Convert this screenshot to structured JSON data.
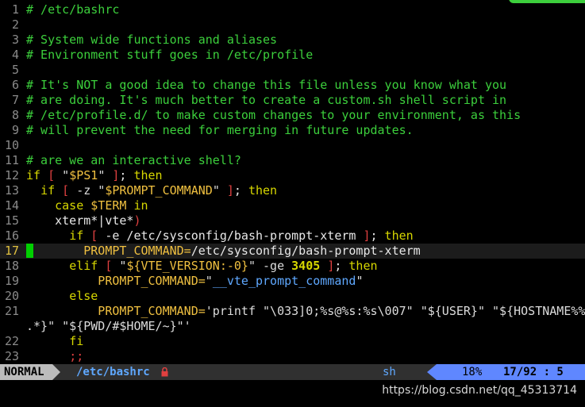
{
  "lines": [
    {
      "n": "1",
      "spans": [
        {
          "t": "# /etc/bashrc",
          "c": "c-com"
        }
      ]
    },
    {
      "n": "2",
      "spans": []
    },
    {
      "n": "3",
      "spans": [
        {
          "t": "# System wide functions and aliases",
          "c": "c-com"
        }
      ]
    },
    {
      "n": "4",
      "spans": [
        {
          "t": "# Environment stuff goes in /etc/profile",
          "c": "c-com"
        }
      ]
    },
    {
      "n": "5",
      "spans": []
    },
    {
      "n": "6",
      "spans": [
        {
          "t": "# It's NOT a good idea to change this file unless you know what you",
          "c": "c-com"
        }
      ]
    },
    {
      "n": "7",
      "spans": [
        {
          "t": "# are doing. It's much better to create a custom.sh shell script in",
          "c": "c-com"
        }
      ]
    },
    {
      "n": "8",
      "spans": [
        {
          "t": "# /etc/profile.d/ to make custom changes to your environment, as this",
          "c": "c-com"
        }
      ]
    },
    {
      "n": "9",
      "spans": [
        {
          "t": "# will prevent the need for merging in future updates.",
          "c": "c-com"
        }
      ]
    },
    {
      "n": "10",
      "spans": []
    },
    {
      "n": "11",
      "spans": [
        {
          "t": "# are we an interactive shell?",
          "c": "c-com"
        }
      ]
    },
    {
      "n": "12",
      "spans": [
        {
          "t": "if",
          "c": "c-kw"
        },
        {
          "t": " ",
          "c": "c-txt"
        },
        {
          "t": "[",
          "c": "c-red"
        },
        {
          "t": " \"",
          "c": "c-str"
        },
        {
          "t": "$PS1",
          "c": "c-var"
        },
        {
          "t": "\" ",
          "c": "c-str"
        },
        {
          "t": "]",
          "c": "c-red"
        },
        {
          "t": "; ",
          "c": "c-txt"
        },
        {
          "t": "then",
          "c": "c-kw"
        }
      ]
    },
    {
      "n": "13",
      "spans": [
        {
          "t": "  ",
          "c": "c-txt"
        },
        {
          "t": "if",
          "c": "c-kw"
        },
        {
          "t": " ",
          "c": "c-txt"
        },
        {
          "t": "[",
          "c": "c-red"
        },
        {
          "t": " -z \"",
          "c": "c-str"
        },
        {
          "t": "$PROMPT_COMMAND",
          "c": "c-var"
        },
        {
          "t": "\" ",
          "c": "c-str"
        },
        {
          "t": "]",
          "c": "c-red"
        },
        {
          "t": "; ",
          "c": "c-txt"
        },
        {
          "t": "then",
          "c": "c-kw"
        }
      ]
    },
    {
      "n": "14",
      "spans": [
        {
          "t": "    ",
          "c": "c-txt"
        },
        {
          "t": "case",
          "c": "c-kw"
        },
        {
          "t": " ",
          "c": "c-txt"
        },
        {
          "t": "$TERM",
          "c": "c-var"
        },
        {
          "t": " ",
          "c": "c-txt"
        },
        {
          "t": "in",
          "c": "c-kw"
        }
      ]
    },
    {
      "n": "15",
      "spans": [
        {
          "t": "    xterm*|vte*",
          "c": "c-txt"
        },
        {
          "t": ")",
          "c": "c-red"
        }
      ]
    },
    {
      "n": "16",
      "spans": [
        {
          "t": "      ",
          "c": "c-txt"
        },
        {
          "t": "if",
          "c": "c-kw"
        },
        {
          "t": " ",
          "c": "c-txt"
        },
        {
          "t": "[",
          "c": "c-red"
        },
        {
          "t": " -e /etc/sysconfig/bash-prompt-xterm ",
          "c": "c-txt"
        },
        {
          "t": "]",
          "c": "c-red"
        },
        {
          "t": "; ",
          "c": "c-txt"
        },
        {
          "t": "then",
          "c": "c-kw"
        }
      ]
    },
    {
      "n": "17",
      "cur": true,
      "spans": [
        {
          "t": " ",
          "c": "cursor"
        },
        {
          "t": "       PROMPT_COMMAND=",
          "c": "c-var"
        },
        {
          "t": "/etc/sysconfig/bash-prompt-xterm",
          "c": "c-txt"
        }
      ]
    },
    {
      "n": "18",
      "spans": [
        {
          "t": "      ",
          "c": "c-txt"
        },
        {
          "t": "elif",
          "c": "c-kw"
        },
        {
          "t": " ",
          "c": "c-txt"
        },
        {
          "t": "[",
          "c": "c-red"
        },
        {
          "t": " \"",
          "c": "c-str"
        },
        {
          "t": "${VTE_VERSION:-0}",
          "c": "c-var"
        },
        {
          "t": "\" -ge ",
          "c": "c-str"
        },
        {
          "t": "3405",
          "c": "c-num"
        },
        {
          "t": " ",
          "c": "c-txt"
        },
        {
          "t": "]",
          "c": "c-red"
        },
        {
          "t": "; ",
          "c": "c-txt"
        },
        {
          "t": "then",
          "c": "c-kw"
        }
      ]
    },
    {
      "n": "19",
      "spans": [
        {
          "t": "          PROMPT_COMMAND=",
          "c": "c-var"
        },
        {
          "t": "\"",
          "c": "c-str"
        },
        {
          "t": "__vte_prompt_command",
          "c": "c-fn"
        },
        {
          "t": "\"",
          "c": "c-str"
        }
      ]
    },
    {
      "n": "20",
      "spans": [
        {
          "t": "      ",
          "c": "c-txt"
        },
        {
          "t": "else",
          "c": "c-kw"
        }
      ]
    },
    {
      "n": "21",
      "spans": [
        {
          "t": "          PROMPT_COMMAND=",
          "c": "c-var"
        },
        {
          "t": "'printf \"\\033]0;%s@%s:%s\\007\" \"${USER}\" \"${HOSTNAME%%",
          "c": "c-str"
        }
      ]
    },
    {
      "n": "",
      "spans": [
        {
          "t": ".*}\" \"${PWD/#$HOME/~}\"'",
          "c": "c-str"
        }
      ]
    },
    {
      "n": "22",
      "spans": [
        {
          "t": "      ",
          "c": "c-txt"
        },
        {
          "t": "fi",
          "c": "c-kw"
        }
      ]
    },
    {
      "n": "23",
      "spans": [
        {
          "t": "      ",
          "c": "c-txt"
        },
        {
          "t": ";;",
          "c": "c-red"
        }
      ]
    }
  ],
  "statusline": {
    "mode": "NORMAL",
    "filename": "/etc/bashrc",
    "lock_icon": "lock-icon",
    "filetype": "sh",
    "percent": "18%",
    "linecol": "17/92 :  5"
  },
  "watermark": "https://blog.csdn.net/qq_45313714",
  "colors": {
    "comment": "#3ccf3c",
    "keyword": "#d7d700",
    "bracket": "#e04040",
    "variable": "#f0c040",
    "function": "#5fa8ff",
    "position_bg": "#5f87ff"
  }
}
